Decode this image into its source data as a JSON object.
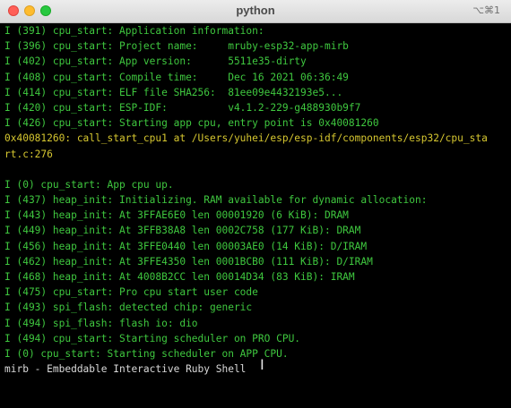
{
  "window": {
    "title": "python",
    "shortcut": "⌥⌘1"
  },
  "lines": [
    "I (391) cpu_start: Application information:",
    "I (396) cpu_start: Project name:     mruby-esp32-app-mirb",
    "I (402) cpu_start: App version:      5511e35-dirty",
    "I (408) cpu_start: Compile time:     Dec 16 2021 06:36:49",
    "I (414) cpu_start: ELF file SHA256:  81ee09e4432193e5...",
    "I (420) cpu_start: ESP-IDF:          v4.1.2-229-g488930b9f7",
    "I (426) cpu_start: Starting app cpu, entry point is 0x40081260",
    "0x40081260: call_start_cpu1 at /Users/yuhei/esp/esp-idf/components/esp32/cpu_sta",
    "rt.c:276",
    "",
    "I (0) cpu_start: App cpu up.",
    "I (437) heap_init: Initializing. RAM available for dynamic allocation:",
    "I (443) heap_init: At 3FFAE6E0 len 00001920 (6 KiB): DRAM",
    "I (449) heap_init: At 3FFB38A8 len 0002C758 (177 KiB): DRAM",
    "I (456) heap_init: At 3FFE0440 len 00003AE0 (14 KiB): D/IRAM",
    "I (462) heap_init: At 3FFE4350 len 0001BCB0 (111 KiB): D/IRAM",
    "I (468) heap_init: At 4008B2CC len 00014D34 (83 KiB): IRAM",
    "I (475) cpu_start: Pro cpu start user code",
    "I (493) spi_flash: detected chip: generic",
    "I (494) spi_flash: flash io: dio",
    "I (494) cpu_start: Starting scheduler on PRO CPU.",
    "I (0) cpu_start: Starting scheduler on APP CPU.",
    "mirb - Embeddable Interactive Ruby Shell",
    "",
    "",
    "> "
  ],
  "colors": {
    "log_info": "#3fc83f",
    "address_trace": "#d6c730",
    "plain_text": "#dadada",
    "background": "#000000"
  }
}
